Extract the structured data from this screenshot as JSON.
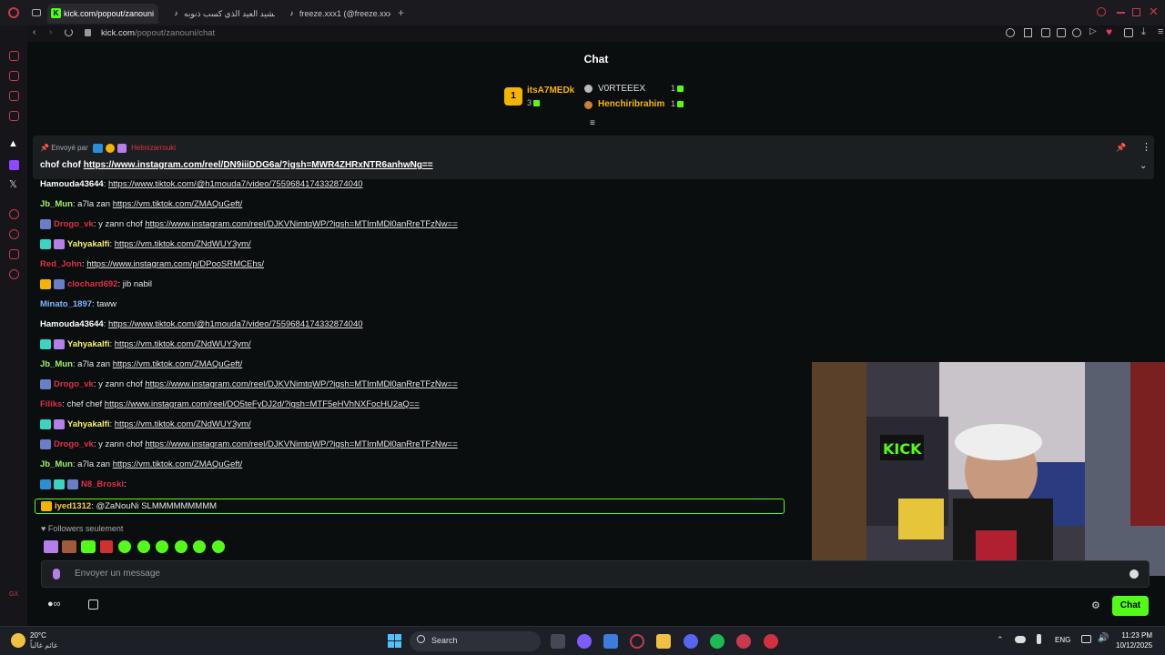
{
  "browser": {
    "tabs": [
      {
        "label": "kick.com/popout/zanouni",
        "active": true
      },
      {
        "label": "نشيد العيد الذي كسب ذنوبه",
        "active": false
      },
      {
        "label": "freeze.xxx1 (@freeze.xxx",
        "active": false
      }
    ],
    "url_host": "kick.com",
    "url_path": "/popout/zanouni/chat"
  },
  "chat": {
    "title": "Chat",
    "leaderboard": {
      "first": {
        "rank": "1",
        "name": "itsA7MEDk",
        "count": "3"
      },
      "second": {
        "name": "V0RTEEEX",
        "count": "1"
      },
      "third": {
        "name": "Henchiribrahim",
        "count": "1"
      }
    },
    "pinned": {
      "sent_by_label": "Envoyé par",
      "sender": "Helmizarrouki",
      "text": "chof chof",
      "link": "https://www.instagram.com/reel/DN9iiiDDG6a/?igsh=MWR4ZHRxNTR6anhwNg=="
    },
    "messages": [
      {
        "user": "Hamouda43644",
        "color": "#ffffff",
        "text": "",
        "link": "https://www.tiktok.com/@h1mouda7/video/7559684174332874040"
      },
      {
        "user": "Jb_Mun",
        "color": "#9cf26b",
        "text": "a7la zan",
        "link": "https://vm.tiktok.com/ZMAQuGeft/"
      },
      {
        "user": "Drogo_vk",
        "color": "#e02f45",
        "text": "y zann chof",
        "link": "https://www.instagram.com/reel/DJKVNimtqWP/?igsh=MTImMDl0anRreTFzNw=="
      },
      {
        "user": "Yahyakalfi",
        "color": "#f7f26b",
        "text": "",
        "link": "https://vm.tiktok.com/ZNdWUY3ym/"
      },
      {
        "user": "Red_John",
        "color": "#e02f45",
        "text": "",
        "link": "https://www.instagram.com/p/DPooSRMCEhs/"
      },
      {
        "user": "clochard692",
        "color": "#e02f45",
        "text": "jib nabil",
        "link": ""
      },
      {
        "user": "Minato_1897",
        "color": "#7fb6ff",
        "text": "taww",
        "link": ""
      },
      {
        "user": "Hamouda43644",
        "color": "#ffffff",
        "text": "",
        "link": "https://www.tiktok.com/@h1mouda7/video/7559684174332874040"
      },
      {
        "user": "Yahyakalfi",
        "color": "#f7f26b",
        "text": "",
        "link": "https://vm.tiktok.com/ZNdWUY3ym/"
      },
      {
        "user": "Jb_Mun",
        "color": "#9cf26b",
        "text": "a7la zan",
        "link": "https://vm.tiktok.com/ZMAQuGeft/"
      },
      {
        "user": "Drogo_vk",
        "color": "#e02f45",
        "text": "y zann chof",
        "link": "https://www.instagram.com/reel/DJKVNimtqWP/?igsh=MTImMDl0anRreTFzNw=="
      },
      {
        "user": "Filiks",
        "color": "#e02f45",
        "text": "chef chef",
        "link": "https://www.instagram.com/reel/DO5teFyDJ2d/?igsh=MTF5eHVhNXFocHU2aQ=="
      },
      {
        "user": "Yahyakalfi",
        "color": "#f7f26b",
        "text": "",
        "link": "https://vm.tiktok.com/ZNdWUY3ym/"
      },
      {
        "user": "Drogo_vk",
        "color": "#e02f45",
        "text": "y zann chof",
        "link": "https://www.instagram.com/reel/DJKVNimtqWP/?igsh=MTImMDl0anRreTFzNw=="
      },
      {
        "user": "Jb_Mun",
        "color": "#9cf26b",
        "text": "a7la zan",
        "link": "https://vm.tiktok.com/ZMAQuGeft/"
      },
      {
        "user": "N8_Broski",
        "color": "#e02f45",
        "text": "",
        "link": ""
      },
      {
        "user": "iyed1312",
        "color": "#f7c948",
        "text": "@ZaNouNi SLMMMMMMMMM",
        "link": ""
      }
    ],
    "followers_only": "Followers seulement",
    "input_placeholder": "Envoyer un message",
    "send_label": "Chat"
  },
  "taskbar": {
    "weather_temp": "20°C",
    "weather_desc": "غائم غالباً",
    "search_label": "Search",
    "lang": "ENG",
    "time": "11:23 PM",
    "date": "10/12/2025"
  },
  "colors": {
    "kick_green": "#53fc18",
    "accent_red": "#c73a4e"
  }
}
